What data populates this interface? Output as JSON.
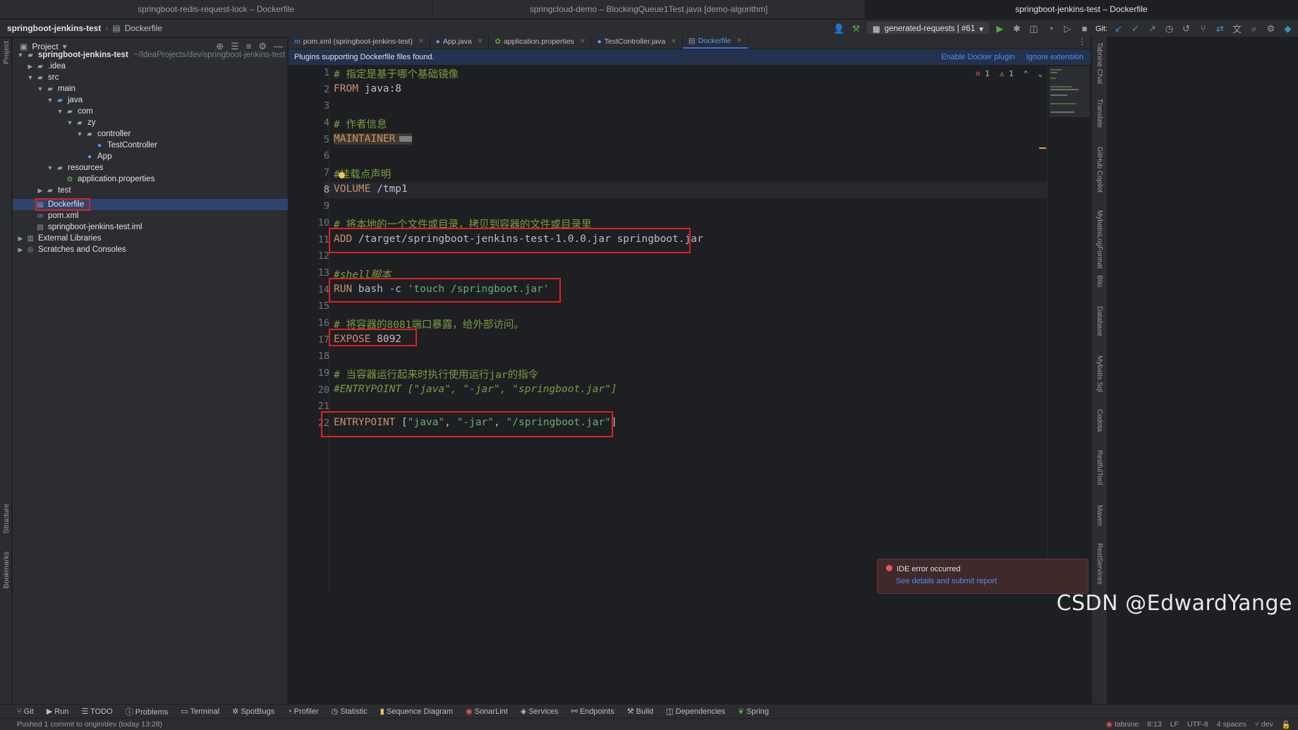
{
  "window_tabs": [
    "springboot-redis-request-lock – Dockerfile",
    "springcloud-demo – BlockingQueue1Test.java [demo-algorithm]",
    "springboot-jenkins-test – Dockerfile"
  ],
  "toolbar": {
    "project_name": "springboot-jenkins-test",
    "file_name": "Dockerfile",
    "run_config": "generated-requests | #61",
    "git_label": "Git:"
  },
  "project_panel": {
    "title": "Project",
    "tree": [
      {
        "label": "springboot-jenkins-test",
        "path": "~/IdeaProjects/dev/springboot-jenkins-test"
      },
      {
        "label": ".idea"
      },
      {
        "label": "src"
      },
      {
        "label": "main"
      },
      {
        "label": "java"
      },
      {
        "label": "com"
      },
      {
        "label": "zy"
      },
      {
        "label": "controller"
      },
      {
        "label": "TestController"
      },
      {
        "label": "App"
      },
      {
        "label": "resources"
      },
      {
        "label": "application.properties"
      },
      {
        "label": "test"
      },
      {
        "label": "Dockerfile"
      },
      {
        "label": "pom.xml"
      },
      {
        "label": "springboot-jenkins-test.iml"
      },
      {
        "label": "External Libraries"
      },
      {
        "label": "Scratches and Consoles"
      }
    ]
  },
  "editor_tabs": [
    "pom.xml (springboot-jenkins-test)",
    "App.java",
    "application.properties",
    "TestController.java",
    "Dockerfile"
  ],
  "notice": {
    "text": "Plugins supporting Dockerfile files found.",
    "enable": "Enable Docker plugin",
    "ignore": "Ignore extension"
  },
  "inspection": {
    "errors": "1",
    "warnings": "1"
  },
  "code": {
    "line_numbers": [
      "1",
      "2",
      "3",
      "4",
      "5",
      "6",
      "7",
      "8",
      "9",
      "10",
      "11",
      "12",
      "13",
      "14",
      "15",
      "16",
      "17",
      "18",
      "19",
      "20",
      "21",
      "22"
    ],
    "l1": "# 指定是基于哪个基础镜像",
    "l2_kw": "FROM",
    "l2_rest": " java:8",
    "l4": "# 作者信息",
    "l5_kw": "MAINTAINER",
    "l7": "#挂载点声明",
    "l8_kw": "VOLUME",
    "l8_rest": " /tmp1",
    "l10": "# 将本地的一个文件或目录，拷贝到容器的文件或目录里",
    "l11_kw": "ADD",
    "l11_rest": " /target/springboot-jenkins-test-1.0.0.jar springboot.jar",
    "l13": "#shell脚本",
    "l14_kw": "RUN",
    "l14_rest": " bash -c ",
    "l14_str": "'touch /springboot.jar'",
    "l16": "# 将容器的8081端口暴露，给外部访问。",
    "l17_kw": "EXPOSE",
    "l17_rest": " 8092",
    "l19": "# 当容器运行起来时执行使用运行jar的指令",
    "l20": "#ENTRYPOINT [\"java\", \"-jar\", \"springboot.jar\"]",
    "l22_kw": "ENTRYPOINT",
    "l22_rest": " [",
    "l22_s1": "\"java\"",
    "l22_c1": ", ",
    "l22_s2": "\"-jar\"",
    "l22_c2": ", ",
    "l22_s3": "\"/springboot.jar\"",
    "l22_end": "]"
  },
  "bottom_tools": [
    "Git",
    "Run",
    "TODO",
    "Problems",
    "Terminal",
    "SpotBugs",
    "Profiler",
    "Statistic",
    "Sequence Diagram",
    "SonarLint",
    "Services",
    "Endpoints",
    "Build",
    "Dependencies",
    "Spring"
  ],
  "status": {
    "message": "Pushed 1 commit to origin/dev (today 13:28)",
    "tabnine": "tabnine",
    "position": "8:13",
    "line_sep": "LF",
    "encoding": "UTF-8",
    "indent": "4 spaces",
    "branch": "dev"
  },
  "left_stripe": [
    "Project",
    "Structure",
    "Bookmarks"
  ],
  "right_stripe": [
    "Tabnine Chat",
    "Translate",
    "GitHub Copilot",
    "MybatisLogFormat",
    "Bito",
    "Database",
    "Mybatis Sql",
    "Codota",
    "RestfulTool",
    "Maven",
    "RestServices"
  ],
  "error_popup": {
    "title": "IDE error occurred",
    "link": "See details and submit report"
  },
  "watermark": "CSDN @EdwardYange",
  "colors": {
    "accent": "#3574f0",
    "highlight_box": "#e02020",
    "keyword": "#cf8e6d",
    "comment": "#7a9c3f",
    "string": "#6aab73"
  }
}
